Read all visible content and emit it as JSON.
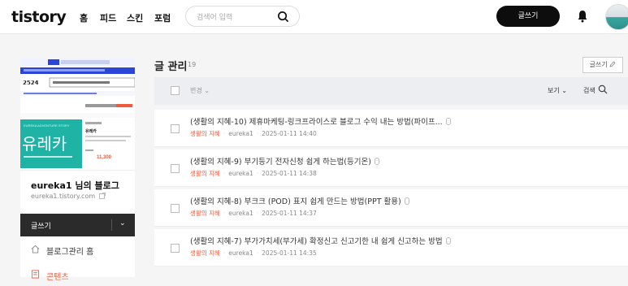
{
  "header": {
    "logo": "tistory",
    "nav": [
      {
        "label": "홈"
      },
      {
        "label": "피드"
      },
      {
        "label": "스킨"
      },
      {
        "label": "포럼"
      }
    ],
    "search_placeholder": "검색어 입력",
    "write_label": "글쓰기"
  },
  "sidebar": {
    "blog_title": "eureka1 님의 블로그",
    "blog_url": "eureka1.tistory.com",
    "write_label": "글쓰기",
    "items": [
      {
        "label": "블로그관리 홈",
        "icon": "home-icon"
      },
      {
        "label": "콘텐츠",
        "icon": "document-icon",
        "active": true
      }
    ],
    "thumb_text": "유레카",
    "thumb_number": "11,300"
  },
  "main": {
    "title": "글 관리",
    "count": "19",
    "write_label": "글쓰기",
    "toolbar": {
      "change_label": "변경",
      "view_label": "보기",
      "search_label": "검색"
    },
    "posts": [
      {
        "title": "(생활의 지혜-10) 제휴마케팅-링크프라이스로 블로그 수익 내는 방법(파이프...",
        "category": "생활의 지혜",
        "author": "eureka1",
        "date": "2025-01-11 14:40"
      },
      {
        "title": "(생활의 지혜-9) 부기등기 전자신청 쉽게 하는법(등기온)",
        "category": "생활의 지혜",
        "author": "eureka1",
        "date": "2025-01-11 14:38"
      },
      {
        "title": "(생활의 지혜-8) 부크크 (POD) 표지 쉽게 만드는 방법(PPT 활용)",
        "category": "생활의 지혜",
        "author": "eureka1",
        "date": "2025-01-11 14:37"
      },
      {
        "title": "(생활의 지혜-7) 부가가치세(부가세) 확정신고 신고기한 내 쉽게 신고하는 방법",
        "category": "생활의 지혜",
        "author": "eureka1",
        "date": "2025-01-11 14:35"
      }
    ]
  },
  "colors": {
    "accent": "#ef5a3c",
    "dark": "#0d0d0d"
  }
}
